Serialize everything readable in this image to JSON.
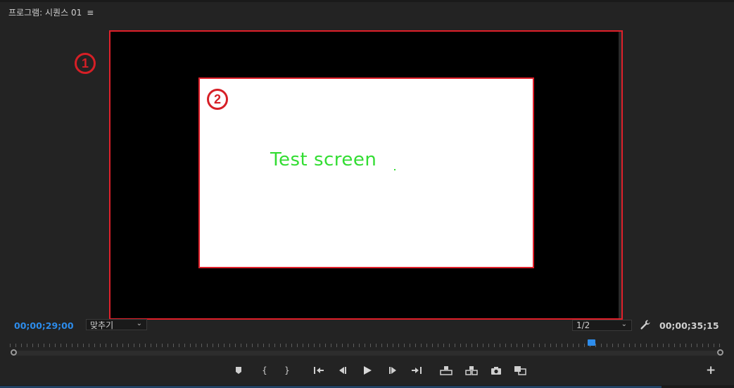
{
  "panel": {
    "title": "프로그램: 시퀀스 01",
    "menu_icon": "hamburger-menu-icon"
  },
  "viewer": {
    "frame_text": "Test screen",
    "callouts": [
      "1",
      "2"
    ],
    "accent_color": "#e0202a"
  },
  "controls": {
    "timecode_current": "00;00;29;00",
    "timecode_duration": "00;00;35;15",
    "fit_select": {
      "value": "맞추기",
      "options": [
        "맞추기"
      ]
    },
    "resolution_select": {
      "value": "1/2",
      "options": [
        "1/2"
      ]
    },
    "timecode_color": "#2d8ceb",
    "playhead_position_fraction": 0.815
  },
  "transport": {
    "buttons": [
      "add-marker-icon",
      "mark-in-icon",
      "mark-out-icon",
      "go-to-in-icon",
      "step-back-icon",
      "play-icon",
      "step-forward-icon",
      "go-to-out-icon",
      "lift-icon",
      "extract-icon",
      "export-frame-icon",
      "comparison-view-icon"
    ],
    "add_button": "add-button-icon"
  }
}
